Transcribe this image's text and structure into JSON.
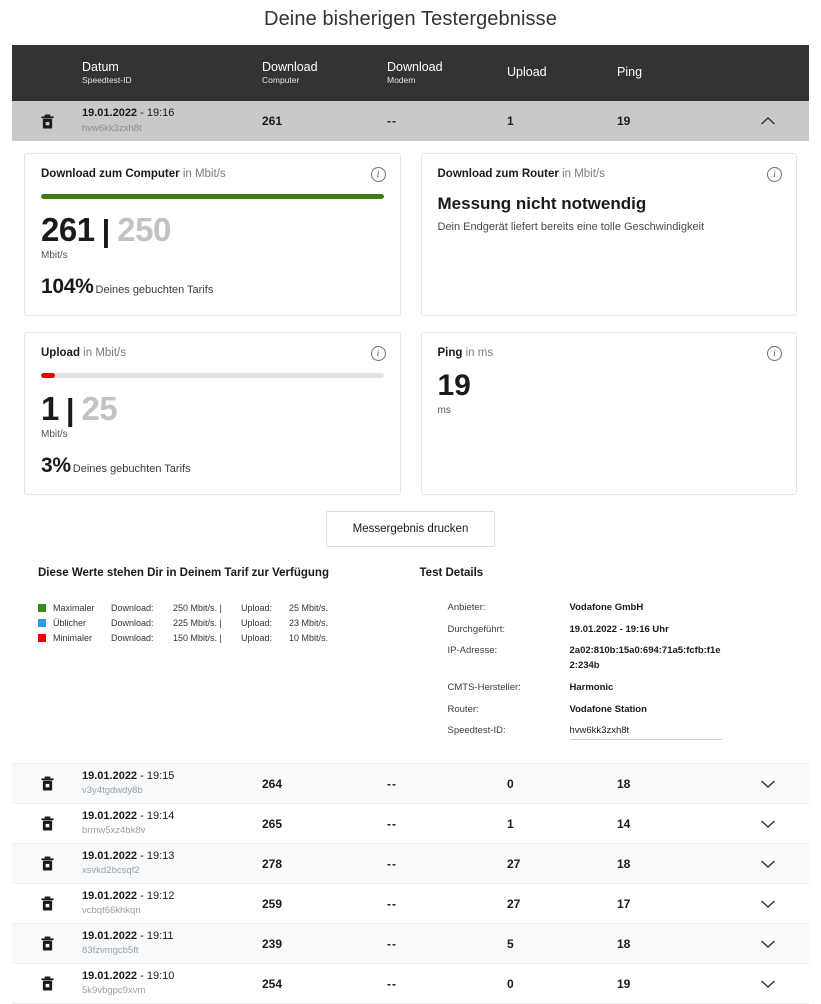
{
  "page": {
    "title": "Deine bisherigen Testergebnisse"
  },
  "table": {
    "headers": {
      "date_main": "Datum",
      "date_sub": "Speedtest-ID",
      "dl_computer_main": "Download",
      "dl_computer_sub": "Computer",
      "dl_modem_main": "Download",
      "dl_modem_sub": "Modem",
      "upload": "Upload",
      "ping": "Ping"
    },
    "expanded_row": {
      "date": "19.01.2022",
      "time": "19:16",
      "speedtest_id": "hvw6kk3zxh8t",
      "download_computer": "261",
      "download_modem": "--",
      "upload": "1",
      "ping": "19",
      "chevron": "chevron-up"
    },
    "rows": [
      {
        "date": "19.01.2022",
        "time": "19:15",
        "speedtest_id": "v3y4tgdwdy8b",
        "download_computer": "264",
        "download_modem": "--",
        "upload": "0",
        "ping": "18",
        "chevron": "chevron-down"
      },
      {
        "date": "19.01.2022",
        "time": "19:14",
        "speedtest_id": "brmw5xz4bk8v",
        "download_computer": "265",
        "download_modem": "--",
        "upload": "1",
        "ping": "14",
        "chevron": "chevron-down"
      },
      {
        "date": "19.01.2022",
        "time": "19:13",
        "speedtest_id": "xsvkd2bcsqf2",
        "download_computer": "278",
        "download_modem": "--",
        "upload": "27",
        "ping": "18",
        "chevron": "chevron-down"
      },
      {
        "date": "19.01.2022",
        "time": "19:12",
        "speedtest_id": "vcbqt66khkqn",
        "download_computer": "259",
        "download_modem": "--",
        "upload": "27",
        "ping": "17",
        "chevron": "chevron-down"
      },
      {
        "date": "19.01.2022",
        "time": "19:11",
        "speedtest_id": "83fzvmgcb5ft",
        "download_computer": "239",
        "download_modem": "--",
        "upload": "5",
        "ping": "18",
        "chevron": "chevron-down"
      },
      {
        "date": "19.01.2022",
        "time": "19:10",
        "speedtest_id": "5k9vbgpc9xvm",
        "download_computer": "254",
        "download_modem": "--",
        "upload": "0",
        "ping": "19",
        "chevron": "chevron-down"
      }
    ]
  },
  "detail": {
    "download_computer_card": {
      "title_bold": "Download zum Computer",
      "title_rest": " in Mbit/s",
      "value": "261",
      "separator": "|",
      "max": "250",
      "unit": "Mbit/s",
      "percent": "104%",
      "percent_label": "Deines gebuchten Tarifs",
      "bar_color": "#3c7d16",
      "bar_percent": 100,
      "info": "i"
    },
    "download_router_card": {
      "title_bold": "Download zum Router",
      "title_rest": " in Mbit/s",
      "message": "Messung nicht notwendig",
      "submessage": "Dein Endgerät liefert bereits eine tolle Geschwindigkeit",
      "info": "i"
    },
    "upload_card": {
      "title_bold": "Upload",
      "title_rest": " in Mbit/s",
      "value": "1",
      "separator": "|",
      "max": "25",
      "unit": "Mbit/s",
      "percent": "3%",
      "percent_label": "Deines gebuchten Tarifs",
      "bar_color": "#e60000",
      "bar_percent": 4,
      "info": "i"
    },
    "ping_card": {
      "title_bold": "Ping",
      "title_rest": " in ms",
      "value": "19",
      "unit": "ms",
      "info": "i"
    },
    "print_button": "Messergebnis drucken",
    "tariff": {
      "title": "Diese Werte stehen Dir in Deinem Tarif zur Verfügung",
      "dl_label": "Download:",
      "ul_label": "Upload:",
      "rows": [
        {
          "color": "#3c8a1e",
          "name": "Maximaler",
          "download": "250 Mbit/s. |",
          "upload": "25 Mbit/s."
        },
        {
          "color": "#3399ee",
          "name": "Üblicher",
          "download": "225 Mbit/s. |",
          "upload": "23 Mbit/s."
        },
        {
          "color": "#e60000",
          "name": "Minimaler",
          "download": "150 Mbit/s. |",
          "upload": "10 Mbit/s."
        }
      ]
    },
    "test_details": {
      "title": "Test Details",
      "rows": [
        {
          "key": "Anbieter:",
          "value": "Vodafone GmbH",
          "style": "bold"
        },
        {
          "key": "Durchgeführt:",
          "value": "19.01.2022 - 19:16 Uhr",
          "style": "bold"
        },
        {
          "key": "IP-Adresse:",
          "value": "2a02:810b:15a0:694:71a5:fcfb:f1e2:234b",
          "style": "bold"
        },
        {
          "key": "CMTS-Hersteller:",
          "value": "Harmonic",
          "style": "bold"
        },
        {
          "key": "Router:",
          "value": "Vodafone Station",
          "style": "bold"
        },
        {
          "key": "Speedtest-ID:",
          "value": "hvw6kk3zxh8t",
          "style": "plain"
        }
      ]
    }
  }
}
